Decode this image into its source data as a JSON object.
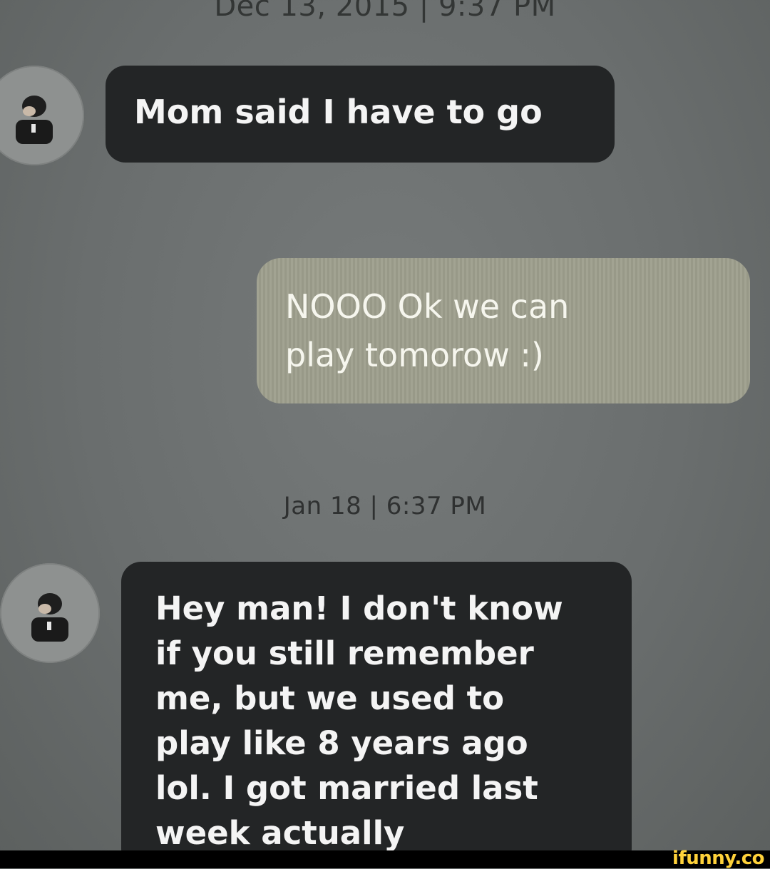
{
  "conversation": {
    "timestamps": [
      "Dec 13, 2015 | 9:37 PM",
      "Jan 18 | 6:37 PM"
    ],
    "messages": [
      {
        "direction": "incoming",
        "text": "Mom said I have to go"
      },
      {
        "direction": "outgoing",
        "text": "NOOO Ok we can\nplay tomorow :)"
      },
      {
        "direction": "incoming",
        "text": "Hey man! I don't know\nif you still remember\nme, but we used to\nplay like 8 years ago\nlol. I got married last\nweek actually"
      }
    ]
  },
  "avatar": {
    "icon": "user-avatar-icon"
  },
  "colors": {
    "background": "#6f7373",
    "incoming_bubble": "#232526",
    "outgoing_bubble": "#9d9e8c",
    "watermark": "#ffd23a"
  },
  "watermark": {
    "text": "ifunny.co"
  }
}
